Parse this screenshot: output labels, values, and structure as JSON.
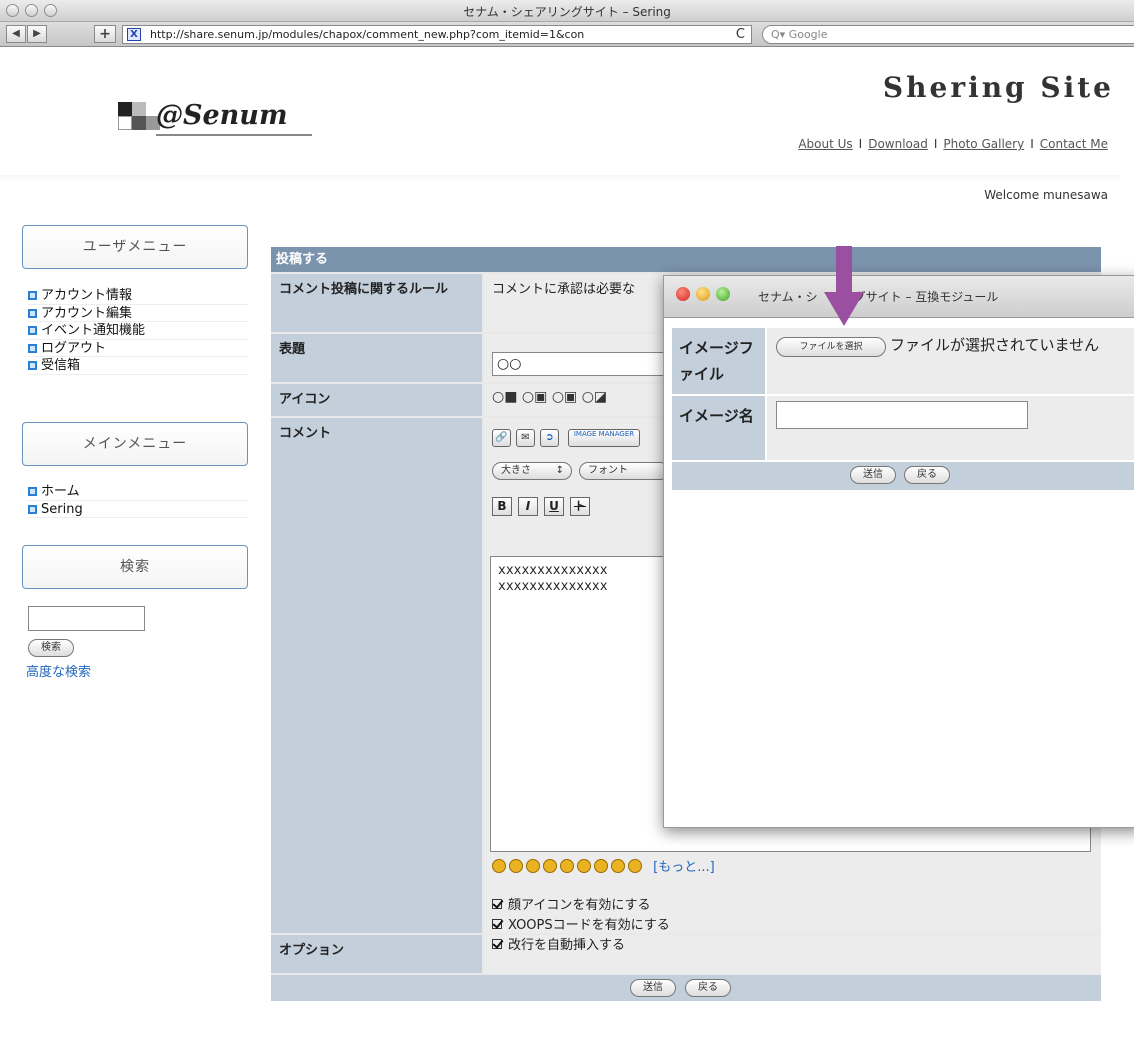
{
  "browser": {
    "window_title": "セナム・シェアリングサイト – Sering",
    "url": "http://share.senum.jp/modules/chapox/comment_new.php?com_itemid=1&con",
    "search_placeholder": "Google",
    "back_label": "◀",
    "forward_label": "▶",
    "add_label": "+",
    "reload_label": "C"
  },
  "header": {
    "logo_text": "@Senum",
    "site_title": "Shering Site",
    "nav": [
      "About Us",
      "Download",
      "Photo Gallery",
      "Contact Me"
    ],
    "nav_separator": "I",
    "welcome": "Welcome munesawa"
  },
  "sidebar": {
    "user_menu_title": "ユーザメニュー",
    "user_menu_items": [
      "アカウント情報",
      "アカウント編集",
      "イベント通知機能",
      "ログアウト",
      "受信箱"
    ],
    "main_menu_title": "メインメニュー",
    "main_menu_items": [
      "ホーム",
      "Sering"
    ],
    "search_title": "検索",
    "search_button": "検索",
    "advanced_search": "高度な検索"
  },
  "form": {
    "header": "投稿する",
    "rules_label": "コメント投稿に関するルール",
    "rules_value": "コメントに承認は必要な",
    "title_label": "表題",
    "title_value": "○○",
    "icon_label": "アイコン",
    "comment_label": "コメント",
    "size_select": "大きさ",
    "font_select": "フォント",
    "image_manager_label": "IMAGE MANAGER",
    "format_buttons": [
      "B",
      "I",
      "U",
      "ト"
    ],
    "comment_text": "xxxxxxxxxxxxxx\nxxxxxxxxxxxxxx",
    "more_link": "[もっと...]",
    "options_label": "オプション",
    "options": [
      "顔アイコンを有効にする",
      "XOOPSコードを有効にする",
      "改行を自動挿入する"
    ],
    "submit_button": "送信",
    "back_button": "戻る"
  },
  "popup": {
    "title": "セナム・シ　リングサイト – 互換モジュール",
    "image_file_label": "イメージファイル",
    "file_button": "ファイルを選択",
    "file_status": "ファイルが選択されていません",
    "image_name_label": "イメージ名",
    "submit_button": "送信",
    "back_button": "戻る"
  },
  "colors": {
    "table_header": "#7b93ad",
    "label_cell": "#c3cfdb",
    "link": "#2266bb",
    "annotation_arrow": "#9b4fa0"
  }
}
